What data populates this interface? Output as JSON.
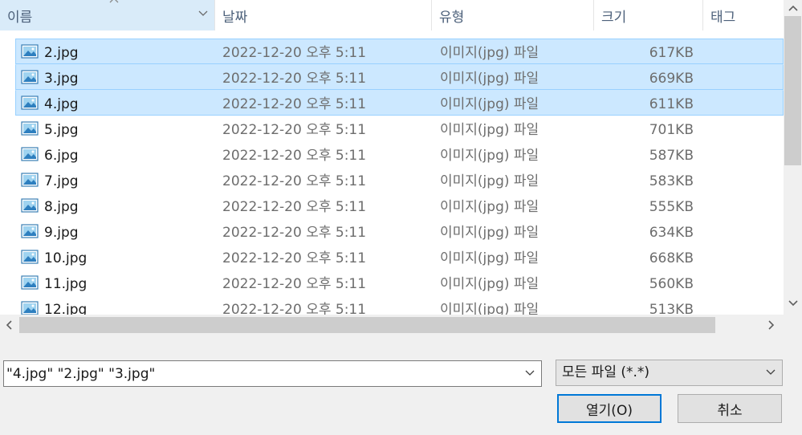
{
  "columns": {
    "name": "이름",
    "date": "날짜",
    "type": "유형",
    "size": "크기",
    "tags": "태그"
  },
  "files": [
    {
      "name": "2.jpg",
      "date": "2022-12-20 오후 5:11",
      "type": "이미지(jpg) 파일",
      "size": "617KB",
      "selected": true
    },
    {
      "name": "3.jpg",
      "date": "2022-12-20 오후 5:11",
      "type": "이미지(jpg) 파일",
      "size": "669KB",
      "selected": true
    },
    {
      "name": "4.jpg",
      "date": "2022-12-20 오후 5:11",
      "type": "이미지(jpg) 파일",
      "size": "611KB",
      "selected": true
    },
    {
      "name": "5.jpg",
      "date": "2022-12-20 오후 5:11",
      "type": "이미지(jpg) 파일",
      "size": "701KB",
      "selected": false
    },
    {
      "name": "6.jpg",
      "date": "2022-12-20 오후 5:11",
      "type": "이미지(jpg) 파일",
      "size": "587KB",
      "selected": false
    },
    {
      "name": "7.jpg",
      "date": "2022-12-20 오후 5:11",
      "type": "이미지(jpg) 파일",
      "size": "583KB",
      "selected": false
    },
    {
      "name": "8.jpg",
      "date": "2022-12-20 오후 5:11",
      "type": "이미지(jpg) 파일",
      "size": "555KB",
      "selected": false
    },
    {
      "name": "9.jpg",
      "date": "2022-12-20 오후 5:11",
      "type": "이미지(jpg) 파일",
      "size": "634KB",
      "selected": false
    },
    {
      "name": "10.jpg",
      "date": "2022-12-20 오후 5:11",
      "type": "이미지(jpg) 파일",
      "size": "668KB",
      "selected": false
    },
    {
      "name": "11.jpg",
      "date": "2022-12-20 오후 5:11",
      "type": "이미지(jpg) 파일",
      "size": "560KB",
      "selected": false
    },
    {
      "name": "12.jpg",
      "date": "2022-12-20 오후 5:11",
      "type": "이미지(jpg) 파일",
      "size": "513KB",
      "selected": false
    }
  ],
  "file_icon": "image-file-icon",
  "filename_input": {
    "value": "\"4.jpg\" \"2.jpg\" \"3.jpg\""
  },
  "file_type_filter": {
    "selected": "모든 파일 (*.*)"
  },
  "buttons": {
    "open": "열기(O)",
    "cancel": "취소"
  },
  "colors": {
    "selection_bg": "#cce8ff",
    "selection_border": "#99d1ff",
    "active_header_bg": "#d9ebf9",
    "default_button_border": "#0078d7"
  }
}
